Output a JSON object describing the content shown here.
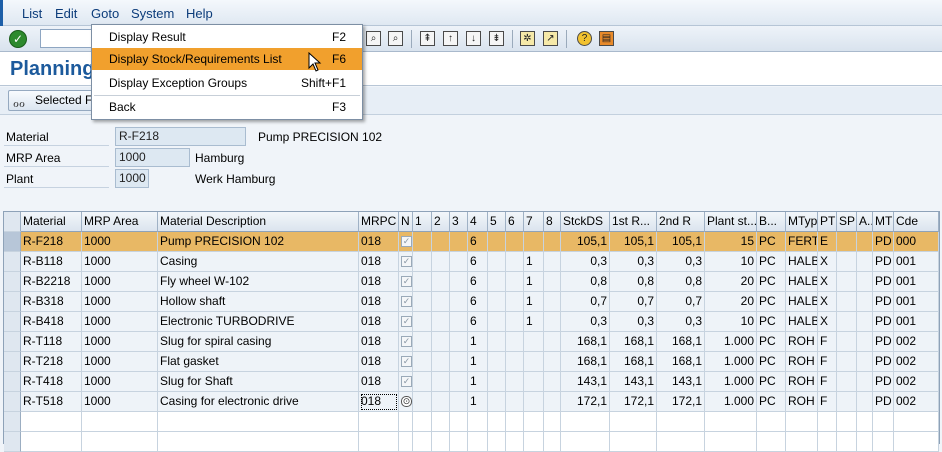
{
  "menubar": {
    "items": [
      "List",
      "Edit",
      "Goto",
      "System",
      "Help"
    ]
  },
  "dropdown": {
    "items": [
      {
        "label": "Display Result",
        "shortcut": "F2"
      },
      {
        "label": "Display Stock/Requirements List",
        "shortcut": "F6"
      },
      {
        "label": "Display Exception Groups",
        "shortcut": "Shift+F1"
      },
      {
        "label": "Back",
        "shortcut": "F3"
      }
    ],
    "highlight_color": "#f1a02d"
  },
  "title": "Planning",
  "app_toolbar": {
    "selected_button": "Selected F"
  },
  "header": {
    "material_label": "Material",
    "material_value": "R-F218",
    "material_desc": "Pump PRECISION 102",
    "mrp_area_label": "MRP Area",
    "mrp_area_value": "1000",
    "mrp_area_desc": "Hamburg",
    "plant_label": "Plant",
    "plant_value": "1000",
    "plant_desc": "Werk Hamburg"
  },
  "grid": {
    "columns": [
      "Material",
      "MRP Area",
      "Material Description",
      "MRPC",
      "N",
      "1",
      "2",
      "3",
      "4",
      "5",
      "6",
      "7",
      "8",
      "StckDS",
      "1st R...",
      "2nd R",
      "Plant st...",
      "B...",
      "MTyp",
      "PT",
      "SP",
      "A...",
      "MT",
      "Cde"
    ],
    "rows": [
      [
        "R-F218",
        "1000",
        "Pump PRECISION 102",
        "018",
        "",
        "",
        "",
        "",
        "6",
        "",
        "",
        "",
        "",
        "105,1",
        "105,1",
        "105,1",
        "15",
        "PC",
        "FERT",
        "E",
        "",
        "",
        "PD",
        "000"
      ],
      [
        "R-B118",
        "1000",
        "Casing",
        "018",
        "",
        "",
        "",
        "",
        "6",
        "",
        "",
        "1",
        "",
        "0,3",
        "0,3",
        "0,3",
        "10",
        "PC",
        "HALB",
        "X",
        "",
        "",
        "PD",
        "001"
      ],
      [
        "R-B2218",
        "1000",
        "Fly wheel W-102",
        "018",
        "",
        "",
        "",
        "",
        "6",
        "",
        "",
        "1",
        "",
        "0,8",
        "0,8",
        "0,8",
        "20",
        "PC",
        "HALB",
        "X",
        "",
        "",
        "PD",
        "001"
      ],
      [
        "R-B318",
        "1000",
        "Hollow shaft",
        "018",
        "",
        "",
        "",
        "",
        "6",
        "",
        "",
        "1",
        "",
        "0,7",
        "0,7",
        "0,7",
        "20",
        "PC",
        "HALB",
        "X",
        "",
        "",
        "PD",
        "001"
      ],
      [
        "R-B418",
        "1000",
        "Electronic TURBODRIVE",
        "018",
        "",
        "",
        "",
        "",
        "6",
        "",
        "",
        "1",
        "",
        "0,3",
        "0,3",
        "0,3",
        "10",
        "PC",
        "HALB",
        "X",
        "",
        "",
        "PD",
        "001"
      ],
      [
        "R-T118",
        "1000",
        "Slug for spiral casing",
        "018",
        "",
        "",
        "",
        "",
        "1",
        "",
        "",
        "",
        "",
        "168,1",
        "168,1",
        "168,1",
        "1.000",
        "PC",
        "ROH",
        "F",
        "",
        "",
        "PD",
        "002"
      ],
      [
        "R-T218",
        "1000",
        "Flat gasket",
        "018",
        "",
        "",
        "",
        "",
        "1",
        "",
        "",
        "",
        "",
        "168,1",
        "168,1",
        "168,1",
        "1.000",
        "PC",
        "ROH",
        "F",
        "",
        "",
        "PD",
        "002"
      ],
      [
        "R-T418",
        "1000",
        "Slug for Shaft",
        "018",
        "",
        "",
        "",
        "",
        "1",
        "",
        "",
        "",
        "",
        "143,1",
        "143,1",
        "143,1",
        "1.000",
        "PC",
        "ROH",
        "F",
        "",
        "",
        "PD",
        "002"
      ],
      [
        "R-T518",
        "1000",
        "Casing for electronic drive",
        "018",
        "",
        "",
        "",
        "",
        "1",
        "",
        "",
        "",
        "",
        "172,1",
        "172,1",
        "172,1",
        "1.000",
        "PC",
        "ROH",
        "F",
        "",
        "",
        "PD",
        "002"
      ]
    ],
    "selected_row": 0,
    "selected_row_color": "#e8b865"
  }
}
